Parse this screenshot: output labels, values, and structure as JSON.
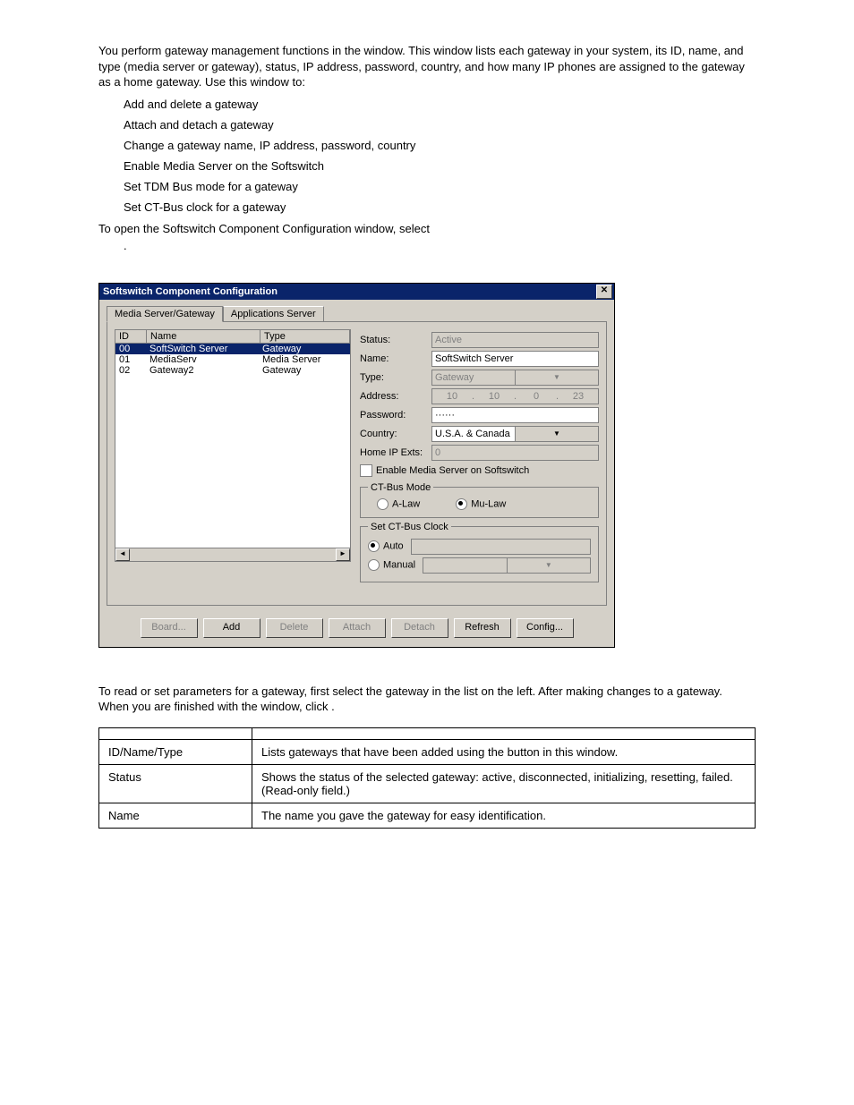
{
  "intro": {
    "p1a": "You perform gateway management functions in the ",
    "p1b": " window. This window lists each gateway in your system, its ID, name, and type (media server or gateway), status, IP address, password, country, and how many IP phones are assigned to the gateway as a home gateway. Use this window to:",
    "bullets": [
      "Add and delete a gateway",
      "Attach and detach a gateway",
      "Change a gateway name, IP address, password, country",
      "Enable Media Server on the Softswitch",
      "Set TDM Bus mode for a gateway",
      "Set CT-Bus clock for a gateway"
    ],
    "p2": "To open the Softswitch Component Configuration window, select",
    "dot": "."
  },
  "dialog": {
    "title": "Softswitch Component Configuration",
    "tabs": {
      "active": "Media Server/Gateway",
      "other": "Applications Server"
    },
    "list": {
      "headers": {
        "id": "ID",
        "name": "Name",
        "type": "Type"
      },
      "rows": [
        {
          "id": "00",
          "name": "SoftSwitch Server",
          "type": "Gateway",
          "selected": true
        },
        {
          "id": "01",
          "name": "MediaServ",
          "type": "Media Server",
          "selected": false
        },
        {
          "id": "02",
          "name": "Gateway2",
          "type": "Gateway",
          "selected": false
        }
      ]
    },
    "form": {
      "status_label": "Status:",
      "status_value": "Active",
      "name_label": "Name:",
      "name_value": "SoftSwitch Server",
      "type_label": "Type:",
      "type_value": "Gateway",
      "address_label": "Address:",
      "address_value": [
        "10",
        "10",
        "0",
        "23"
      ],
      "password_label": "Password:",
      "password_value": "······",
      "country_label": "Country:",
      "country_value": "U.S.A. & Canada",
      "homeip_label": "Home IP Exts:",
      "homeip_value": "0",
      "enable_ms": "Enable Media Server on Softswitch",
      "ctbus_mode": {
        "legend": "CT-Bus Mode",
        "alaw": "A-Law",
        "mulaw": "Mu-Law"
      },
      "ctbus_clock": {
        "legend": "Set CT-Bus Clock",
        "auto": "Auto",
        "manual": "Manual"
      }
    },
    "buttons": {
      "board": "Board...",
      "add": "Add",
      "del": "Delete",
      "attach": "Attach",
      "detach": "Detach",
      "refresh": "Refresh",
      "config": "Config..."
    }
  },
  "after": {
    "p1": "To read or set parameters for a gateway, first select the gateway in the list on the left. After making changes to a gateway. When you are finished with the window, click ",
    "dot": "."
  },
  "table": {
    "rows": [
      {
        "k": "ID/Name/Type",
        "v": "Lists gateways that have been added using the        button in this window."
      },
      {
        "k": "Status",
        "v": "Shows the status of the selected gateway: active, disconnected, initializing, resetting, failed. (Read-only field.)"
      },
      {
        "k": "Name",
        "v": "The name you gave the gateway for easy identification."
      }
    ]
  }
}
